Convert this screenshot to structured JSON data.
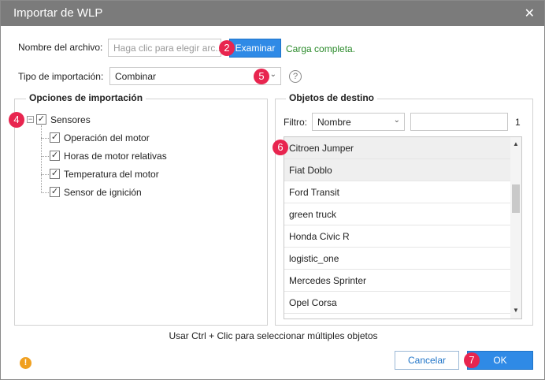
{
  "window": {
    "title": "Importar de WLP",
    "close_glyph": "✕"
  },
  "file": {
    "label": "Nombre del archivo:",
    "placeholder": "Haga clic para elegir arc...",
    "browse_label": "Examinar",
    "status": "Carga completa."
  },
  "import_type": {
    "label": "Tipo de importación:",
    "value": "Combinar",
    "help_glyph": "?"
  },
  "import_options": {
    "legend": "Opciones de importación",
    "root": {
      "label": "Sensores",
      "checked": true
    },
    "children": [
      {
        "label": "Operación del motor",
        "checked": true
      },
      {
        "label": "Horas de motor relativas",
        "checked": true
      },
      {
        "label": "Temperatura del motor",
        "checked": true
      },
      {
        "label": "Sensor de ignición",
        "checked": true
      }
    ]
  },
  "targets": {
    "legend": "Objetos de destino",
    "filter_label": "Filtro:",
    "filter_value": "Nombre",
    "filter_text": "",
    "count": "1",
    "items": [
      "Citroen Jumper",
      "Fiat Doblo",
      "Ford Transit",
      "green truck",
      "Honda Civic R",
      "logistic_one",
      "Mercedes Sprinter",
      "Opel Corsa"
    ],
    "selected": [
      0,
      1
    ]
  },
  "hint": "Usar Ctrl + Clic para seleccionar múltiples objetos",
  "footer": {
    "cancel_label": "Cancelar",
    "ok_label": "OK",
    "warning_glyph": "!"
  },
  "callouts": {
    "browse": "2",
    "sensors": "4",
    "type": "5",
    "list": "6",
    "ok": "7"
  },
  "colors": {
    "titlebar": "#7b7b7b",
    "accent": "#2f8ae6",
    "badge": "#e8254f",
    "status_ok": "#2a8a2a",
    "warning": "#f0a020"
  },
  "icons": [
    "close-icon",
    "chevron-down-icon",
    "help-icon",
    "warning-icon",
    "checkbox-icon",
    "collapse-icon"
  ]
}
